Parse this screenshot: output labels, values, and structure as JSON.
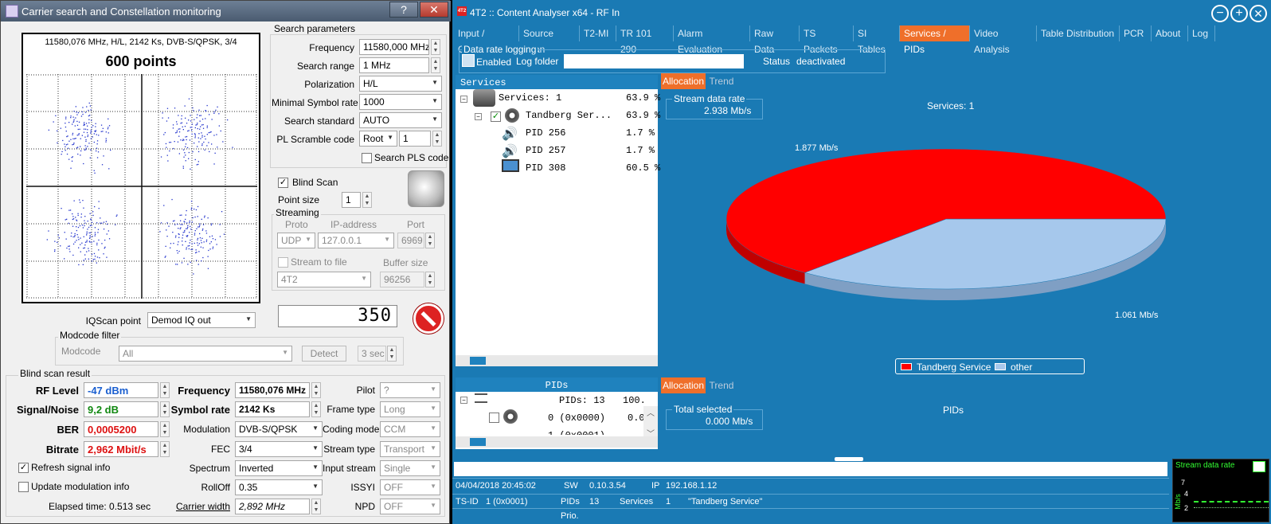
{
  "left_window": {
    "title": "Carrier search and Constellation monitoring",
    "help_btn": "?",
    "close_btn": "✕",
    "plot": {
      "header": "11580,076 MHz, H/L, 2142 Ks, DVB-S/QPSK, 3/4",
      "points_label": "600 points"
    },
    "search": {
      "group": "Search parameters",
      "frequency_label": "Frequency",
      "frequency": "11580,000 MHz",
      "range_label": "Search range",
      "range": "1 MHz",
      "polar_label": "Polarization",
      "polar": "H/L",
      "minsr_label": "Minimal Symbol rate",
      "minsr": "1000",
      "std_label": "Search standard",
      "std": "AUTO",
      "pl_label": "PL Scramble code",
      "pl_mode": "Root",
      "pl_val": "1",
      "pls_label": "Search PLS code"
    },
    "blind": {
      "label": "Blind Scan",
      "checked": "✓",
      "point_size_label": "Point size",
      "point_size": "1"
    },
    "streaming": {
      "group": "Streaming",
      "proto_h": "Proto",
      "ip_h": "IP-address",
      "port_h": "Port",
      "proto": "UDP",
      "ip": "127.0.0.1",
      "port": "6969",
      "tofile": "Stream to file",
      "buffer_h": "Buffer size",
      "file": "4T2",
      "buffer": "96256"
    },
    "iq": {
      "label": "IQScan point",
      "value": "Demod IQ out",
      "counter": "350"
    },
    "modcode": {
      "group": "Modcode filter",
      "label": "Modcode",
      "value": "All",
      "detect": "Detect",
      "interval": "3 sec"
    },
    "result": {
      "group": "Blind scan result",
      "rf_label": "RF Level",
      "rf": "-47 dBm",
      "sn_label": "Signal/Noise",
      "sn": "9,2 dB",
      "ber_label": "BER",
      "ber": "0,0005200",
      "bitrate_label": "Bitrate",
      "bitrate": "2,962 Mbit/s",
      "freq_label": "Frequency",
      "freq": "11580,076 MHz",
      "sr_label": "Symbol rate",
      "sr": "2142 Ks",
      "mod_label": "Modulation",
      "mod": "DVB-S/QPSK",
      "fec_label": "FEC",
      "fec": "3/4",
      "spec_label": "Spectrum",
      "spec": "Inverted",
      "roll_label": "RollOff",
      "roll": "0.35",
      "cw_label": "Carrier width",
      "cw": "2,892 MHz",
      "pilot_label": "Pilot",
      "pilot": "?",
      "frame_label": "Frame type",
      "frame": "Long",
      "coding_label": "Coding mode",
      "coding": "CCM",
      "stype_label": "Stream type",
      "stype": "Transport",
      "input_label": "Input stream",
      "input": "Single",
      "issyi_label": "ISSYI",
      "issyi": "OFF",
      "npd_label": "NPD",
      "npd": "OFF",
      "refresh": "Refresh signal info",
      "update": "Update modulation info",
      "elapsed": "Elapsed time: 0.513 sec"
    },
    "colors": {
      "rf": "#1a5fd0",
      "sn": "#118811",
      "ber": "#dd1111",
      "bitrate": "#dd1111"
    }
  },
  "right_window": {
    "title": "4T2 :: Content Analyser x64  - RF In",
    "logo": "4T2",
    "tabs": [
      "Input / Output",
      "Source Scan",
      "T2-MI",
      "TR 101 290",
      "Alarm Evaluation",
      "Raw Data",
      "TS Packets",
      "SI Tables",
      "Services / PIDs",
      "Video Analysis",
      "Table Distribution",
      "PCR",
      "About",
      "Log"
    ],
    "logging": {
      "group": "Data rate logging",
      "enabled": "Enabled",
      "folder": "Log folder",
      "status_label": "Status",
      "status": "deactivated"
    },
    "services": {
      "header": "Services",
      "rows": [
        {
          "name": "Services: 1",
          "pct": "63.9 %"
        },
        {
          "name": "Tandberg Ser...",
          "pct": "63.9 %"
        },
        {
          "name": "PID 256",
          "pct": "1.7 %"
        },
        {
          "name": "PID 257",
          "pct": "1.7 %"
        },
        {
          "name": "PID 308",
          "pct": "60.5 %"
        }
      ]
    },
    "pids": {
      "header": "PIDs",
      "summary": "PIDs: 13",
      "summary_pct": "100.",
      "row1": "0 (0x0000)",
      "row1_pct": "0.0",
      "row2": "1 (0x0001)"
    },
    "alloc_tab": "Allocation",
    "trend_tab": "Trend",
    "chart": {
      "rate_label": "Stream data rate",
      "rate": "2.938 Mb/s",
      "title": "Services: 1",
      "legend_a": "Tandberg Service",
      "legend_b": "other"
    },
    "chart_data": {
      "type": "pie",
      "title": "Services: 1",
      "labels": [
        "Tandberg Service",
        "other"
      ],
      "values": [
        1.877,
        1.061
      ],
      "value_labels": [
        "1.877 Mb/s",
        "1.061 Mb/s"
      ],
      "colors": [
        "#ff0000",
        "#a6c8ec"
      ],
      "legend": "bottom"
    },
    "pids_panel": {
      "sel_label": "Total selected",
      "sel": "0.000 Mb/s",
      "title": "PIDs"
    },
    "status": {
      "datetime": "04/04/2018 20:45:02",
      "sw_label": "SW",
      "sw": "0.10.3.54",
      "ip_label": "IP",
      "ip": "192.168.1.12",
      "tsid_label": "TS-ID",
      "tsid": "1 (0x0001)",
      "pids_label": "PIDs",
      "pids": "13",
      "svc_label": "Services",
      "svc": "1",
      "svc_name": "\"Tandberg Service\"",
      "prio": "Prio."
    },
    "mini": {
      "title": "Stream data rate",
      "axis": "Mb/s",
      "t7": "7",
      "t4": "4",
      "t2": "2"
    }
  }
}
